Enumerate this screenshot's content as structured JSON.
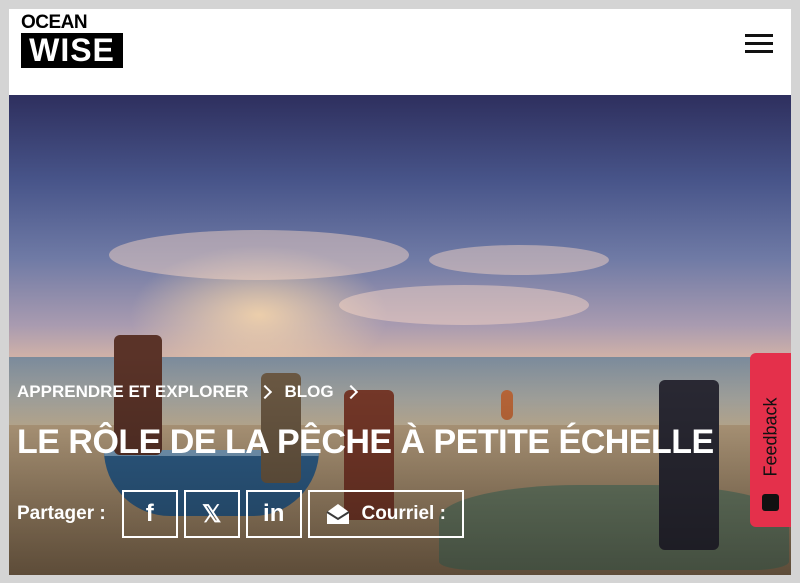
{
  "logo": {
    "line1": "OCEAN",
    "line2": "WISE"
  },
  "header": {
    "menu_icon": "hamburger-menu-icon"
  },
  "breadcrumb": [
    {
      "label": "APPRENDRE ET EXPLORER"
    },
    {
      "label": "BLOG"
    }
  ],
  "page": {
    "title": "LE RÔLE DE LA PÊCHE À PETITE ÉCHELLE"
  },
  "share": {
    "label": "Partager :",
    "facebook_glyph": "f",
    "x_glyph": "𝕏",
    "linkedin_glyph": "in",
    "email_label": "Courriel :"
  },
  "feedback": {
    "label": "Feedback"
  },
  "colors": {
    "feedback": "#e4304b",
    "text_on_image": "#ffffff"
  }
}
